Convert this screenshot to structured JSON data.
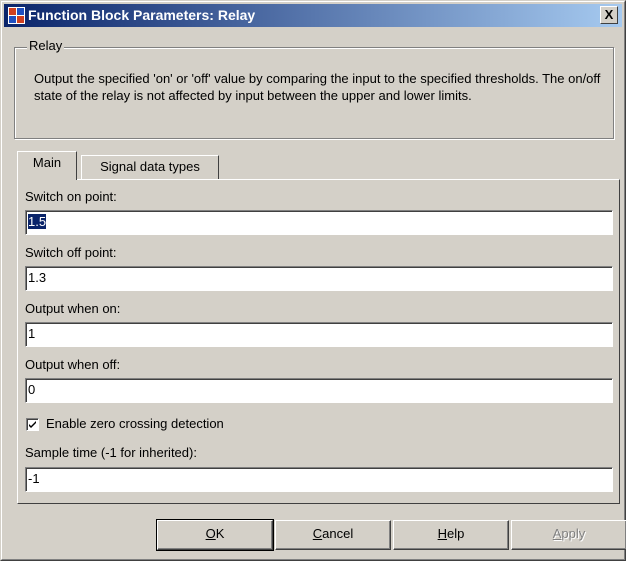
{
  "window": {
    "title": "Function Block Parameters: Relay",
    "close_glyph": "X"
  },
  "group": {
    "legend": "Relay",
    "description": "Output the specified 'on' or 'off' value by comparing the input to the specified thresholds.  The on/off state of the relay is not affected by input between the upper and lower limits."
  },
  "tabs": [
    {
      "label": "Main",
      "active": true
    },
    {
      "label": "Signal data types",
      "active": false
    }
  ],
  "fields": {
    "switch_on": {
      "label": "Switch on point:",
      "value": "1.5"
    },
    "switch_off": {
      "label": "Switch off point:",
      "value": "1.3"
    },
    "output_on": {
      "label": "Output when on:",
      "value": "1"
    },
    "output_off": {
      "label": "Output when off:",
      "value": "0"
    },
    "zero_crossing": {
      "label": "Enable zero crossing detection",
      "checked": true
    },
    "sample_time": {
      "label": "Sample time (-1 for inherited):",
      "value": "-1"
    }
  },
  "buttons": {
    "ok": {
      "mnemonic": "O",
      "rest": "K"
    },
    "cancel": {
      "mnemonic": "C",
      "rest": "ancel"
    },
    "help": {
      "mnemonic": "H",
      "rest": "elp"
    },
    "apply": {
      "mnemonic": "A",
      "rest": "pply",
      "enabled": false
    }
  }
}
